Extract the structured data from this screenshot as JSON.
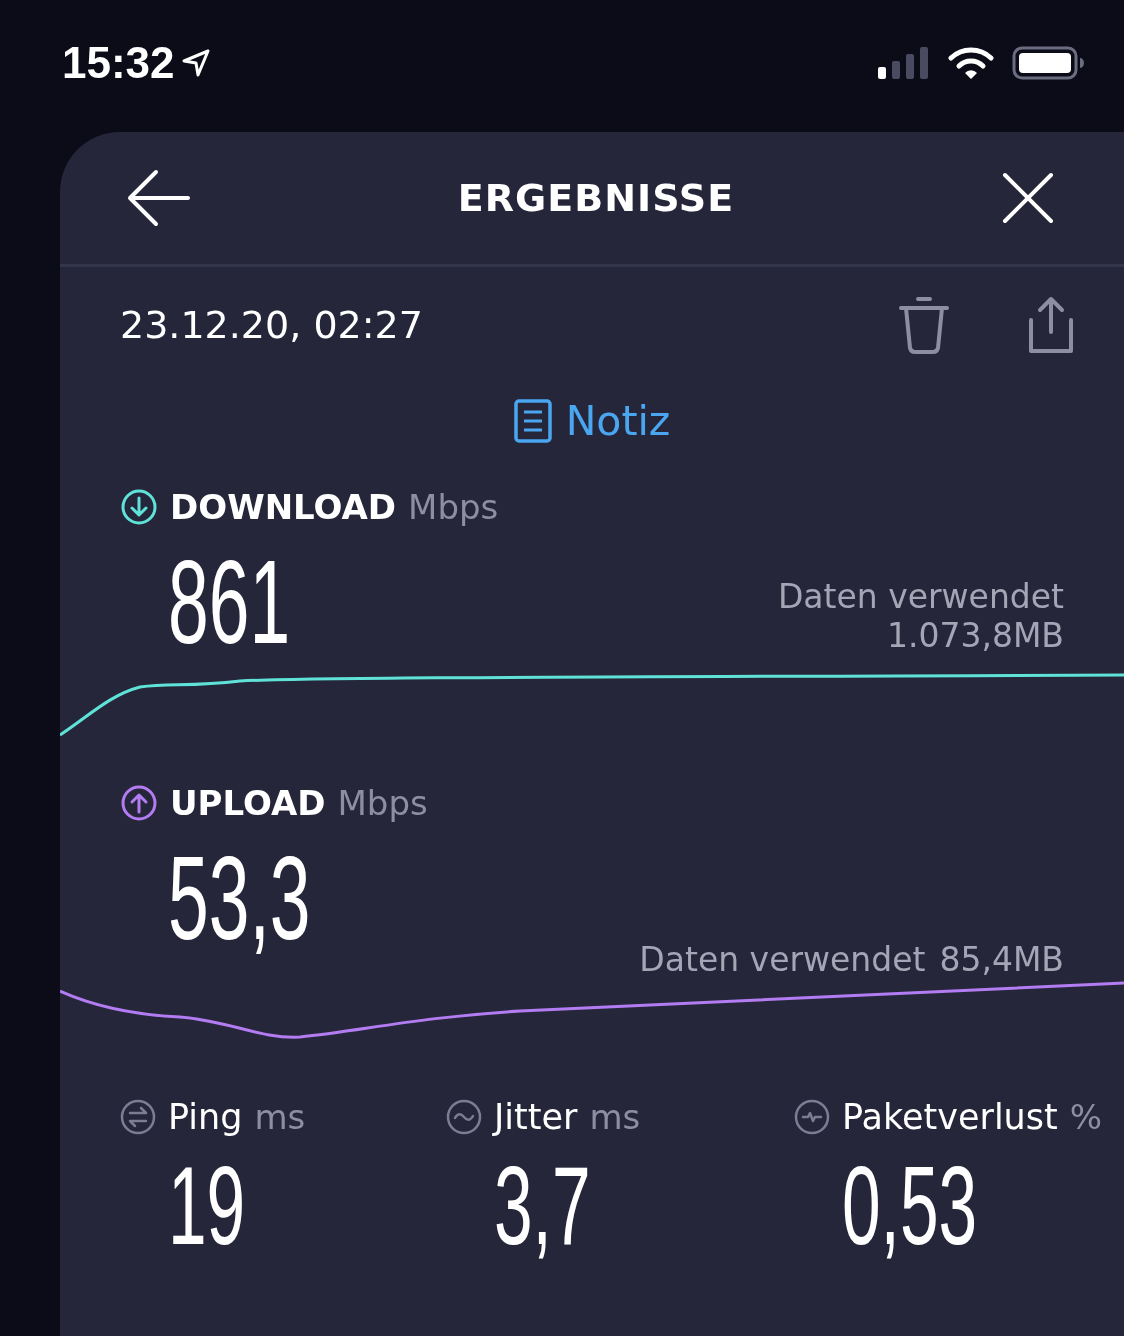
{
  "status_bar": {
    "time": "15:32"
  },
  "header": {
    "title": "ERGEBNISSE"
  },
  "result": {
    "date": "23.12.20, 02:27",
    "note_link": "Notiz"
  },
  "metrics": [
    {
      "label": "DOWNLOAD",
      "unit": "Mbps",
      "value": "861",
      "data_label": "Daten verwendet",
      "data_value": "1.073,8MB",
      "kind": "stacked",
      "color": "#5fe3d9"
    },
    {
      "label": "UPLOAD",
      "unit": "Mbps",
      "value": "53,3",
      "data_label": "Daten verwendet",
      "data_value": "85,4MB",
      "kind": "inline",
      "color": "#b37cf2"
    }
  ],
  "stats": [
    {
      "label": "Ping",
      "unit": "ms",
      "value": "19",
      "kind": "ping"
    },
    {
      "label": "Jitter",
      "unit": "ms",
      "value": "3,7",
      "kind": "jitter"
    },
    {
      "label": "Paketverlust",
      "unit": "%",
      "value": "0,53",
      "kind": "loss"
    }
  ]
}
